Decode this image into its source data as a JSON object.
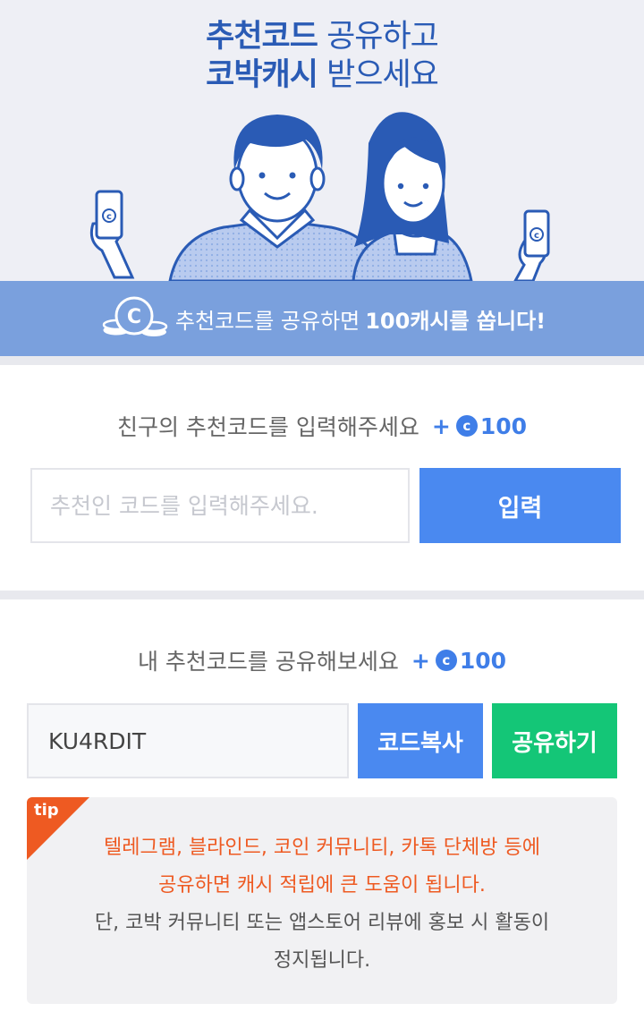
{
  "hero": {
    "title_bold_1": "추천코드",
    "title_rest_1": " 공유하고",
    "title_bold_2": "코박캐시",
    "title_rest_2": " 받으세요",
    "phone_coin_letter": "c"
  },
  "banner": {
    "coin_letter": "C",
    "text": "추천코드를 공유하면",
    "reward": "100캐시를 쏩니다!"
  },
  "enter_section": {
    "label": "친구의 추천코드를 입력해주세요",
    "plus": "+",
    "coin_letter": "c",
    "amount": "100",
    "input_placeholder": "추천인 코드를 입력해주세요.",
    "input_value": "",
    "submit_label": "입력"
  },
  "share_section": {
    "label": "내 추천코드를 공유해보세요",
    "plus": "+",
    "coin_letter": "c",
    "amount": "100",
    "my_code": "KU4RDIT",
    "copy_label": "코드복사",
    "share_label": "공유하기"
  },
  "tip": {
    "badge": "tip",
    "line1": "텔레그램, 블라인드, 코인 커뮤니티, 카톡 단체방 등에",
    "line2": "공유하면 캐시 적립에 큰 도움이 됩니다.",
    "line3": "단, 코박 커뮤니티 또는 앱스토어 리뷰에 홍보 시 활동이",
    "line4": "정지됩니다."
  },
  "colors": {
    "brand_blue": "#2a5bb5",
    "button_blue": "#4a89f0",
    "button_green": "#14c677",
    "banner_blue": "#7aa0dd",
    "tip_orange": "#ee5a22"
  }
}
